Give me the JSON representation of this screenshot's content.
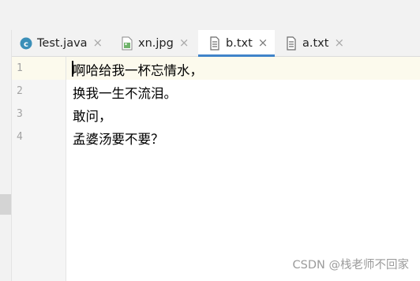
{
  "tabs": [
    {
      "label": "Test.java",
      "icon": "java-class-icon",
      "active": false
    },
    {
      "label": "xn.jpg",
      "icon": "image-file-icon",
      "active": false
    },
    {
      "label": "b.txt",
      "icon": "text-file-icon",
      "active": true
    },
    {
      "label": "a.txt",
      "icon": "text-file-icon",
      "active": false
    }
  ],
  "close_glyph": "×",
  "editor": {
    "line_numbers": [
      "1",
      "2",
      "3",
      "4"
    ],
    "lines": [
      "啊哈给我一杯忘情水，",
      "换我一生不流泪。",
      "敢问，",
      "孟婆汤要不要？"
    ]
  },
  "watermark": "CSDN @栈老师不回家",
  "colors": {
    "active_tab_underline": "#4083c9",
    "current_line": "#fcfaed",
    "java_icon": "#3b8fb8"
  }
}
